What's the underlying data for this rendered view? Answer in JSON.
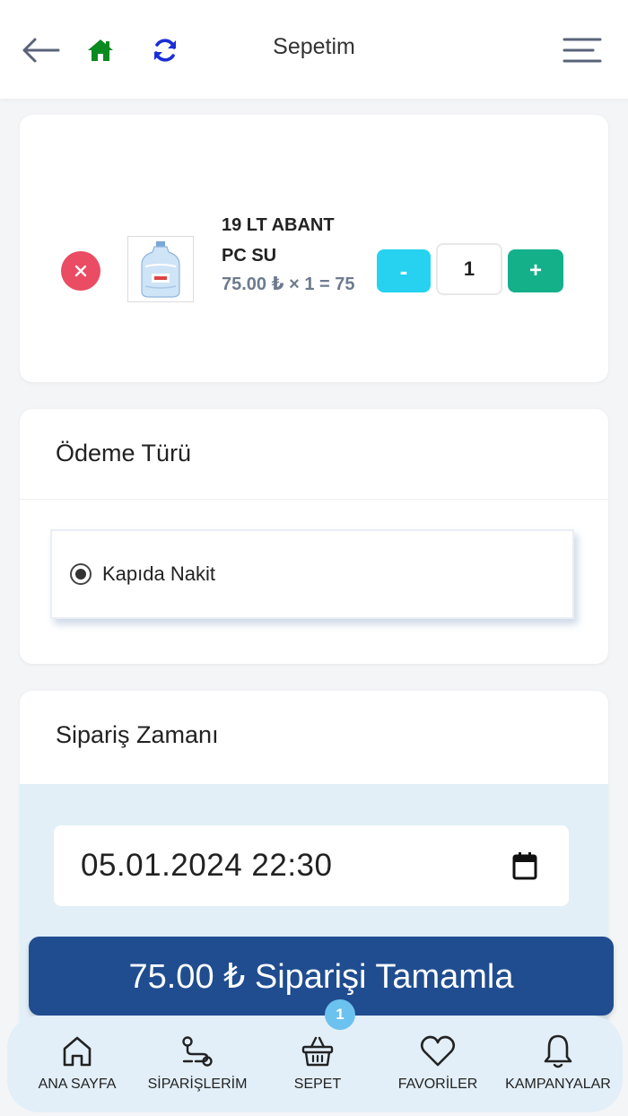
{
  "header": {
    "title": "Sepetim",
    "back_icon": "arrow-left-icon",
    "home_icon": "home-icon",
    "refresh_icon": "refresh-icon",
    "menu_icon": "menu-icon"
  },
  "cart": {
    "items": [
      {
        "name": "19 LT ABANT PC SU",
        "price_line": "75.00 ₺ × 1 = 75",
        "quantity": "1",
        "minus_label": "-",
        "plus_label": "+"
      }
    ]
  },
  "payment": {
    "title": "Ödeme Türü",
    "options": [
      {
        "label": "Kapıda Nakit",
        "selected": true
      }
    ]
  },
  "order_time": {
    "title": "Sipariş Zamanı",
    "datetime_value": "05.01.2024 22:30"
  },
  "submit": {
    "label": "75.00 ₺ Siparişi Tamamla"
  },
  "bottom_nav": {
    "items": [
      {
        "label": "ANA SAYFA",
        "icon": "home-outline-icon"
      },
      {
        "label": "SİPARİŞLERİM",
        "icon": "route-icon"
      },
      {
        "label": "SEPET",
        "icon": "basket-icon",
        "badge": "1"
      },
      {
        "label": "FAVORİLER",
        "icon": "heart-icon"
      },
      {
        "label": "KAMPANYALAR",
        "icon": "bell-icon"
      }
    ]
  },
  "colors": {
    "remove": "#ea4c63",
    "minus": "#26d2f0",
    "plus": "#14b08a",
    "submit": "#1f4d8f",
    "home_icon": "#0a8a1f",
    "refresh_icon": "#1a2fd6",
    "nav_background": "#e2eff8",
    "badge": "#6cc2ef"
  }
}
